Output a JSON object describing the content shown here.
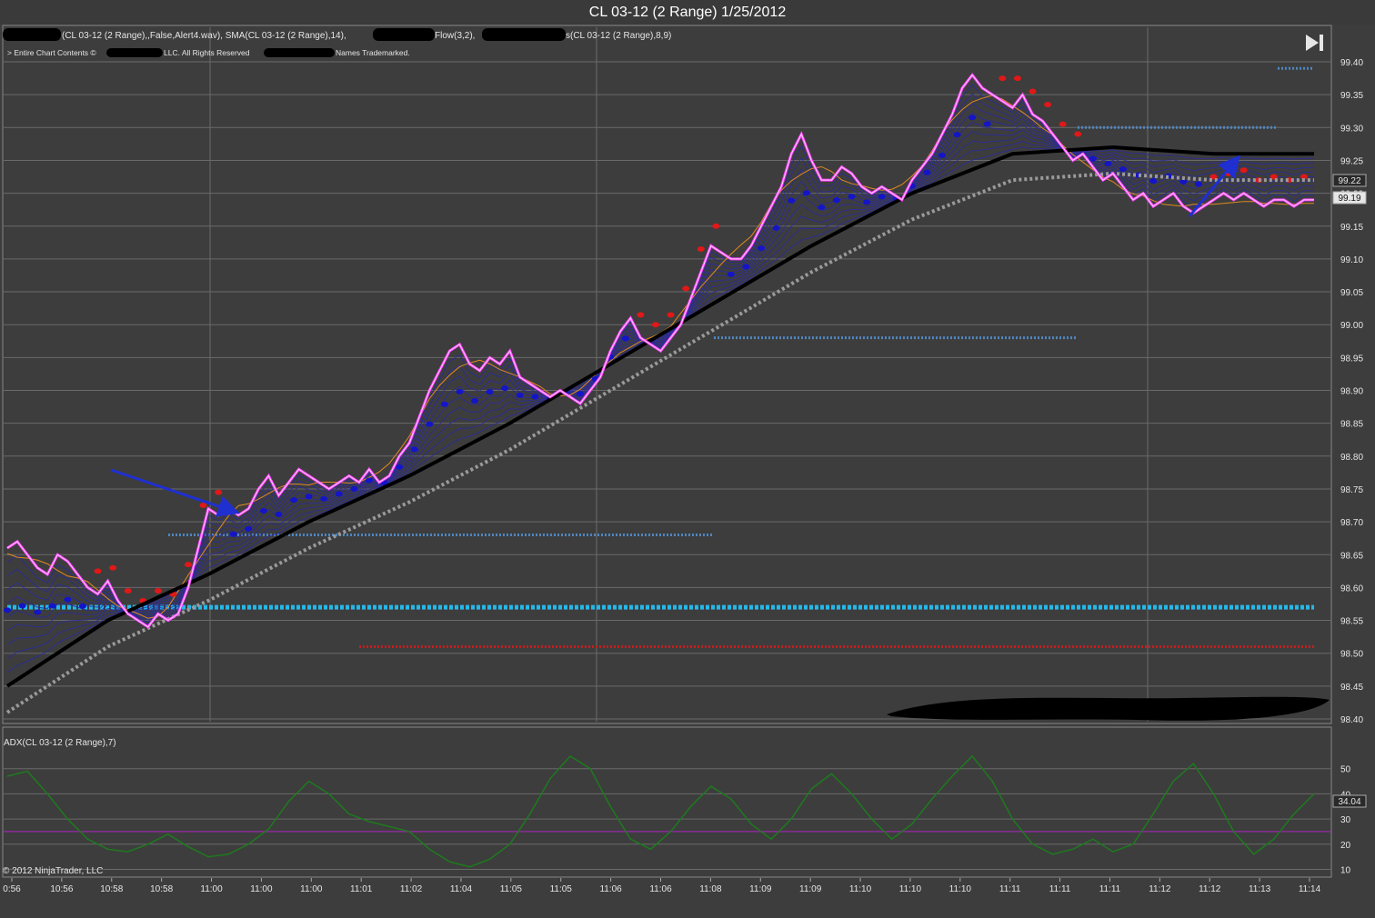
{
  "window": {
    "title": "CL 03-12 (2 Range)  1/25/2012"
  },
  "header": {
    "indicator_line": "(CL 03-12 (2 Range),,False,Alert4.wav), SMA(CL 03-12 (2 Range),14),",
    "indicator_line_2": "Flow(3,2),",
    "indicator_line_3": "s(CL 03-12 (2 Range),8,9)",
    "copyright_a": "> Entire Chart Contents ©",
    "copyright_b": "LLC. All Rights Reserved",
    "copyright_c": "Names Trademarked.",
    "skip_icon": "skip-to-end-icon"
  },
  "footer": {
    "vendor": "© 2012 NinjaTrader, LLC"
  },
  "colors": {
    "background": "#3d3d3d",
    "grid": "#6a6a6a",
    "price": "#ff40ff",
    "sma": "#000000",
    "trend_up_dots": "#1414c8",
    "trend_down_dots": "#e01818",
    "support_line": "#25b8e8",
    "resistance_line": "#c02020",
    "level_dotted": "#4f86c0",
    "adx": "#1e7a1e",
    "adx_threshold": "#8a2b9a",
    "arrow": "#1f2fd0"
  },
  "chart_data": [
    {
      "type": "line",
      "title": "CL 03-12 (2 Range)  1/25/2012",
      "x_tick_labels": [
        "0:56",
        "10:56",
        "10:58",
        "10:58",
        "11:00",
        "11:00",
        "11:00",
        "11:01",
        "11:02",
        "11:04",
        "11:05",
        "11:05",
        "11:06",
        "11:06",
        "11:08",
        "11:09",
        "11:09",
        "11:10",
        "11:10",
        "11:10",
        "11:11",
        "11:11",
        "11:11",
        "11:12",
        "11:12",
        "11:13",
        "11:14"
      ],
      "y_tick_labels": [
        "99.40",
        "99.35",
        "99.30",
        "99.25",
        "99.20",
        "99.15",
        "99.10",
        "99.05",
        "99.00",
        "98.95",
        "98.90",
        "98.85",
        "98.80",
        "98.75",
        "98.70",
        "98.65",
        "98.60",
        "98.55",
        "98.50",
        "98.45",
        "98.40"
      ],
      "ylim": [
        98.4,
        99.4
      ],
      "grid": true,
      "price_labels": {
        "last": "99.22",
        "current": "99.19"
      },
      "series": [
        {
          "name": "price",
          "x": [
            0,
            2,
            4,
            6,
            8,
            10,
            12,
            14,
            16,
            18,
            20,
            22,
            24,
            26,
            28,
            30,
            32,
            34,
            36,
            38,
            40,
            42,
            44,
            46,
            48,
            50,
            52,
            54,
            56,
            58,
            60,
            62,
            64,
            66,
            68,
            70,
            72,
            74,
            76,
            78,
            80,
            82,
            84,
            86,
            88,
            90,
            92,
            94,
            96,
            98,
            100,
            102,
            104,
            106,
            108,
            110,
            112,
            114,
            116,
            118,
            120,
            122,
            124,
            126,
            128,
            130,
            132,
            134,
            136,
            138,
            140,
            142,
            144,
            146,
            148,
            150,
            152,
            154,
            156,
            158,
            160,
            162,
            164,
            166,
            168,
            170,
            172,
            174,
            176,
            178,
            180,
            182,
            184,
            186,
            188,
            190,
            192,
            194,
            196,
            198,
            200,
            202,
            204,
            206,
            208,
            210,
            212,
            214,
            216,
            218,
            220,
            222,
            224,
            226,
            228,
            230,
            232,
            234,
            236,
            238,
            240,
            242,
            244,
            246,
            248,
            250,
            252,
            254,
            256,
            258,
            260
          ],
          "y": [
            98.66,
            98.67,
            98.65,
            98.63,
            98.62,
            98.65,
            98.64,
            98.62,
            98.6,
            98.59,
            98.61,
            98.58,
            98.56,
            98.55,
            98.54,
            98.56,
            98.55,
            98.56,
            98.6,
            98.66,
            98.72,
            98.71,
            98.72,
            98.71,
            98.72,
            98.75,
            98.77,
            98.74,
            98.76,
            98.78,
            98.77,
            98.76,
            98.75,
            98.76,
            98.77,
            98.76,
            98.78,
            98.76,
            98.77,
            98.8,
            98.82,
            98.86,
            98.9,
            98.93,
            98.96,
            98.97,
            98.94,
            98.93,
            98.95,
            98.94,
            98.96,
            98.92,
            98.91,
            98.9,
            98.89,
            98.9,
            98.89,
            98.88,
            98.9,
            98.92,
            98.96,
            98.99,
            99.01,
            98.98,
            98.97,
            98.96,
            98.98,
            99.0,
            99.04,
            99.08,
            99.12,
            99.11,
            99.1,
            99.1,
            99.12,
            99.15,
            99.18,
            99.21,
            99.26,
            99.29,
            99.25,
            99.22,
            99.22,
            99.24,
            99.23,
            99.21,
            99.2,
            99.21,
            99.2,
            99.19,
            99.22,
            99.24,
            99.26,
            99.29,
            99.32,
            99.36,
            99.38,
            99.36,
            99.35,
            99.34,
            99.33,
            99.35,
            99.32,
            99.31,
            99.29,
            99.27,
            99.25,
            99.26,
            99.24,
            99.22,
            99.23,
            99.21,
            99.19,
            99.2,
            99.18,
            99.19,
            99.2,
            99.18,
            99.17,
            99.18,
            99.19,
            99.2,
            99.19,
            99.2,
            99.19,
            99.18,
            99.19,
            99.19,
            99.18,
            99.19,
            99.19
          ]
        },
        {
          "name": "SMA(CL 03-12 (2 Range),14)",
          "x": [
            0,
            20,
            40,
            60,
            80,
            100,
            120,
            140,
            160,
            180,
            200,
            220,
            240,
            260
          ],
          "y": [
            98.45,
            98.55,
            98.62,
            98.7,
            98.77,
            98.85,
            98.94,
            99.03,
            99.12,
            99.2,
            99.26,
            99.27,
            99.26,
            99.26
          ]
        }
      ],
      "levels": [
        {
          "name": "support",
          "y": 98.57
        },
        {
          "name": "resistance",
          "y": 98.51
        },
        {
          "name": "level_a",
          "y": 98.68
        },
        {
          "name": "level_b",
          "y": 98.98
        },
        {
          "name": "level_c",
          "y": 99.3
        },
        {
          "name": "level_d",
          "y": 99.39
        }
      ]
    },
    {
      "type": "line",
      "title": "ADX(CL 03-12 (2 Range),7)",
      "y_tick_labels": [
        "50",
        "40",
        "30",
        "20",
        "10"
      ],
      "ylim": [
        8,
        60
      ],
      "threshold": 25,
      "current_label": "34.04",
      "series": [
        {
          "name": "ADX",
          "x": [
            0,
            4,
            8,
            12,
            16,
            20,
            24,
            28,
            32,
            36,
            40,
            44,
            48,
            52,
            56,
            60,
            64,
            68,
            72,
            76,
            80,
            84,
            88,
            92,
            96,
            100,
            104,
            108,
            112,
            116,
            120,
            124,
            128,
            132,
            136,
            140,
            144,
            148,
            152,
            156,
            160,
            164,
            168,
            172,
            176,
            180,
            184,
            188,
            192,
            196,
            200,
            204,
            208,
            212,
            216,
            220,
            224,
            228,
            232,
            236,
            240,
            244,
            248,
            252,
            256,
            260
          ],
          "y": [
            47,
            49,
            40,
            30,
            22,
            18,
            17,
            20,
            24,
            19,
            15,
            16,
            20,
            26,
            37,
            45,
            40,
            32,
            29,
            27,
            25,
            18,
            13,
            11,
            14,
            20,
            32,
            46,
            55,
            50,
            35,
            22,
            18,
            25,
            35,
            43,
            38,
            28,
            22,
            30,
            42,
            48,
            40,
            30,
            22,
            28,
            38,
            47,
            55,
            45,
            30,
            20,
            16,
            18,
            22,
            17,
            20,
            32,
            45,
            52,
            40,
            25,
            16,
            22,
            32,
            40
          ]
        }
      ]
    }
  ]
}
